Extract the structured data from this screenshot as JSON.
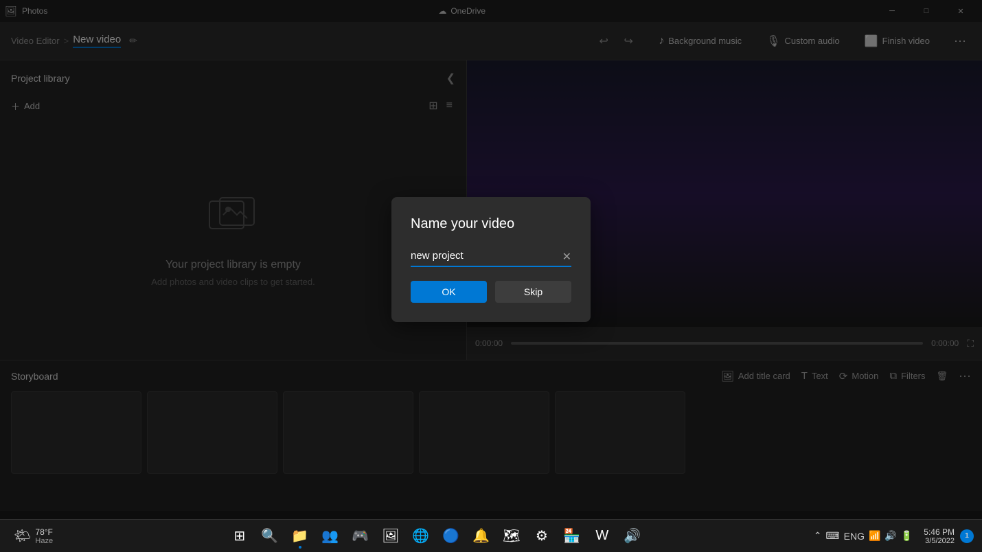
{
  "titleBar": {
    "appName": "Photos",
    "oneDriveLabel": "OneDrive",
    "minimizeLabel": "─",
    "maximizeLabel": "□",
    "closeLabel": "✕"
  },
  "toolbar": {
    "breadcrumbParent": "Video Editor",
    "breadcrumbSeparator": ">",
    "videoTitle": "New video",
    "backgroundMusicLabel": "Background music",
    "customAudioLabel": "Custom audio",
    "finishVideoLabel": "Finish video"
  },
  "projectLibrary": {
    "title": "Project library",
    "addLabel": "Add",
    "emptyTitle": "Your project library is empty",
    "emptySubtitle": "Add photos and video clips to get started."
  },
  "videoControls": {
    "timeStart": "0:00:00",
    "timeEnd": "0:00:00"
  },
  "storyboard": {
    "title": "Storyboard",
    "addTitleCardLabel": "Add title card",
    "textLabel": "Text",
    "motionLabel": "Motion",
    "filtersLabel": "Filters"
  },
  "modal": {
    "title": "Name your video",
    "inputValue": "new project",
    "okLabel": "OK",
    "skipLabel": "Skip"
  },
  "taskbar": {
    "weather": {
      "icon": "🌤",
      "temp": "78°F",
      "condition": "Haze"
    },
    "time": "5:46 PM",
    "date": "3/5/2022",
    "notificationCount": "1",
    "language": "ENG"
  }
}
